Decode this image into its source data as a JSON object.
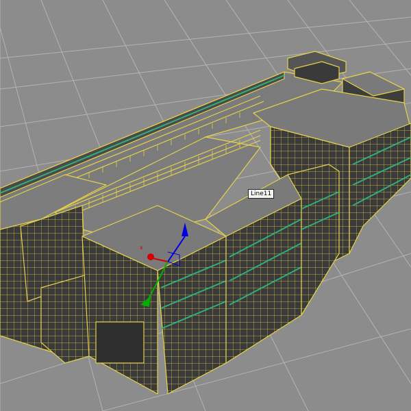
{
  "viewport": {
    "selected_object_label": "Line11",
    "gizmo_axis_x_label": "x",
    "background_color": "#8a8a8a",
    "grid_color": "#b0b0b0",
    "wireframe_color": "#e6d24a",
    "glass_color": "#2fb07a",
    "building_fill_dark": "#3a3a3a",
    "building_fill_roof": "#7a7a7a"
  },
  "gizmo": {
    "x_axis_color": "#d40000",
    "y_axis_color": "#00b000",
    "z_axis_color": "#0000e0"
  }
}
